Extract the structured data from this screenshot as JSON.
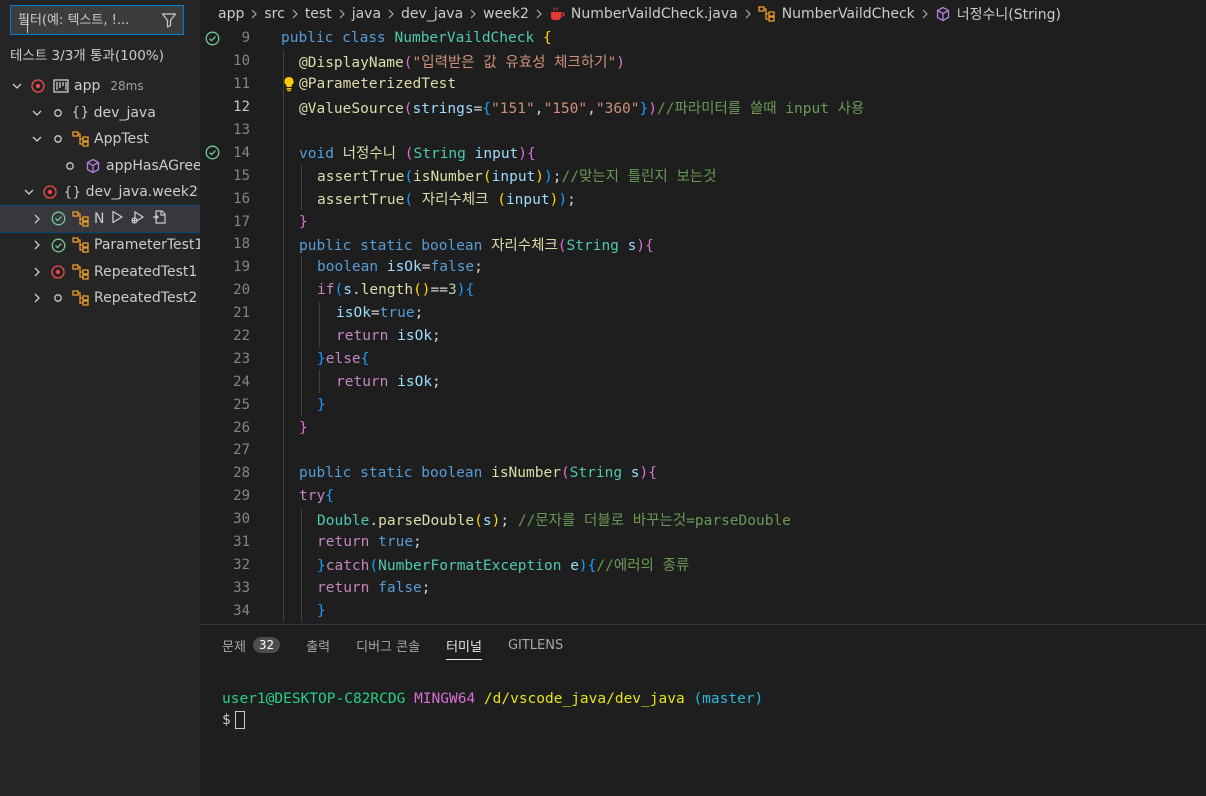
{
  "sidebar": {
    "filter": {
      "placeholder": "필터(예: 텍스트, !..."
    },
    "summary": "테스트 3/3개 통과(100%)",
    "tree": {
      "app": {
        "label": "app",
        "duration": "28ms"
      },
      "dev_java": {
        "label": "dev_java"
      },
      "apptest": {
        "label": "AppTest"
      },
      "app_has_greeting": {
        "label": "appHasAGree"
      },
      "dev_java_week2": {
        "label": "dev_java.week2"
      },
      "number_check": {
        "label": "N"
      },
      "parameter_test": {
        "label": "ParameterTest1"
      },
      "repeated_test1": {
        "label": "RepeatedTest1"
      },
      "repeated_test2": {
        "label": "RepeatedTest2"
      }
    }
  },
  "breadcrumb": {
    "items": [
      "app",
      "src",
      "test",
      "java",
      "dev_java",
      "week2",
      "NumberVaildCheck.java",
      "NumberVaildCheck",
      "너정수니(String)"
    ]
  },
  "editor": {
    "line_numbers": [
      "9",
      "10",
      "11",
      "12",
      "13",
      "14",
      "15",
      "16",
      "17",
      "18",
      "19",
      "20",
      "21",
      "22",
      "23",
      "24",
      "25",
      "26",
      "27",
      "28",
      "29",
      "30",
      "31",
      "32",
      "33",
      "34"
    ],
    "current_line": "12",
    "tokens": {
      "public": "public",
      "class": "class",
      "static": "static",
      "boolean": "boolean",
      "void": "void",
      "return": "return",
      "if": "if",
      "else": "else",
      "try": "try",
      "catch": "catch",
      "true": "true",
      "false": "false",
      "class_name": "NumberVaildCheck",
      "ann_display": "@DisplayName",
      "display_str": "\"입력받은 값 유효성 체크하기\"",
      "ann_param": "@ParameterizedTest",
      "ann_value": "@ValueSource",
      "strings": "strings",
      "s151": "\"151\"",
      "s150": "\"150\"",
      "s360": "\"360\"",
      "cmt12": "//파라미터를 쓸때 input 사용",
      "method1": "너정수니",
      "String": "String",
      "input": "input",
      "assertTrue": "assertTrue",
      "isNumber": "isNumber",
      "cmt15": "//맞는지 틀린지 보는것",
      "method2": "자리수체크",
      "s": "s",
      "isOk": "isOk",
      "length": "length",
      "three": "3",
      "Double": "Double",
      "parseDouble": "parseDouble",
      "cmt30": "//문자를 더블로 바꾸는것=parseDouble",
      "NFE": "NumberFormatException",
      "e": "e",
      "cmt32": "//에러의 종류"
    }
  },
  "panel": {
    "tabs": {
      "problems": "문제",
      "problems_count": "32",
      "output": "출력",
      "debug_console": "디버그 콘솔",
      "terminal": "터미널",
      "gitlens": "GITLENS"
    },
    "terminal": {
      "user": "user1@DESKTOP-C82RCDG",
      "env": "MINGW64",
      "path": "/d/vscode_java/dev_java",
      "branch": "(master)",
      "prompt": "$"
    }
  }
}
